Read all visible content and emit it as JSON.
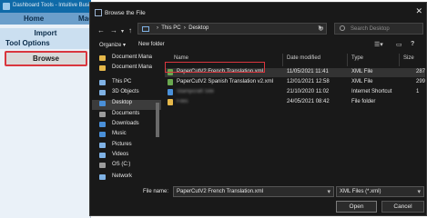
{
  "app": {
    "title": "Dashboard Tools - Intuitive Business",
    "menu": [
      "Home",
      "Mac"
    ],
    "panel": {
      "import": "Import",
      "tool_options": "Tool Options",
      "browse": "Browse"
    }
  },
  "dialog": {
    "title": "Browse the File",
    "close": "✕",
    "address": {
      "path": "This PC  ›  Desktop",
      "segments": [
        "This PC",
        "Desktop"
      ]
    },
    "search": {
      "placeholder": "Search Desktop"
    },
    "commands": {
      "organize": "Organize ▾",
      "new_folder": "New folder"
    },
    "nav": [
      {
        "label": "Document Mana",
        "icon": "folder-icon",
        "color": "#e6b84a"
      },
      {
        "label": "Document Mana",
        "icon": "folder-icon",
        "color": "#e6b84a"
      },
      {
        "label": "This PC",
        "icon": "pc-icon",
        "color": "#7fb2e5"
      },
      {
        "label": "3D Objects",
        "icon": "cube-icon",
        "color": "#7fb2e5"
      },
      {
        "label": "Desktop",
        "icon": "desktop-icon",
        "color": "#4a90d9"
      },
      {
        "label": "Documents",
        "icon": "documents-icon",
        "color": "#9c9c9c"
      },
      {
        "label": "Downloads",
        "icon": "download-icon",
        "color": "#4a90d9"
      },
      {
        "label": "Music",
        "icon": "music-icon",
        "color": "#4a90d9"
      },
      {
        "label": "Pictures",
        "icon": "pictures-icon",
        "color": "#7fb2e5"
      },
      {
        "label": "Videos",
        "icon": "videos-icon",
        "color": "#7fb2e5"
      },
      {
        "label": "OS (C:)",
        "icon": "drive-icon",
        "color": "#9c9c9c"
      },
      {
        "label": "Network",
        "icon": "network-icon",
        "color": "#7fb2e5"
      }
    ],
    "columns": {
      "name": "Name",
      "date": "Date modified",
      "type": "Type",
      "size": "Size"
    },
    "files": [
      {
        "name": "PaperCutV2 French Translation.xml",
        "date": "11/05/2021 11:41",
        "type": "XML File",
        "size": "287"
      },
      {
        "name": "PaperCutV2 Spanish Translation v2.xml",
        "date": "12/01/2021 12:58",
        "type": "XML File",
        "size": "299"
      },
      {
        "name": "Stampcraft Site",
        "date": "21/10/2020 11:02",
        "type": "Internet Shortcut",
        "size": "1"
      },
      {
        "name": "Files",
        "date": "24/05/2021 08:42",
        "type": "File folder",
        "size": ""
      }
    ],
    "filename_label": "File name:",
    "filename_value": "PaperCutV2 French Translation.xml",
    "filetype_value": "XML Files (*.xml)",
    "open_label": "Open",
    "cancel_label": "Cancel"
  }
}
